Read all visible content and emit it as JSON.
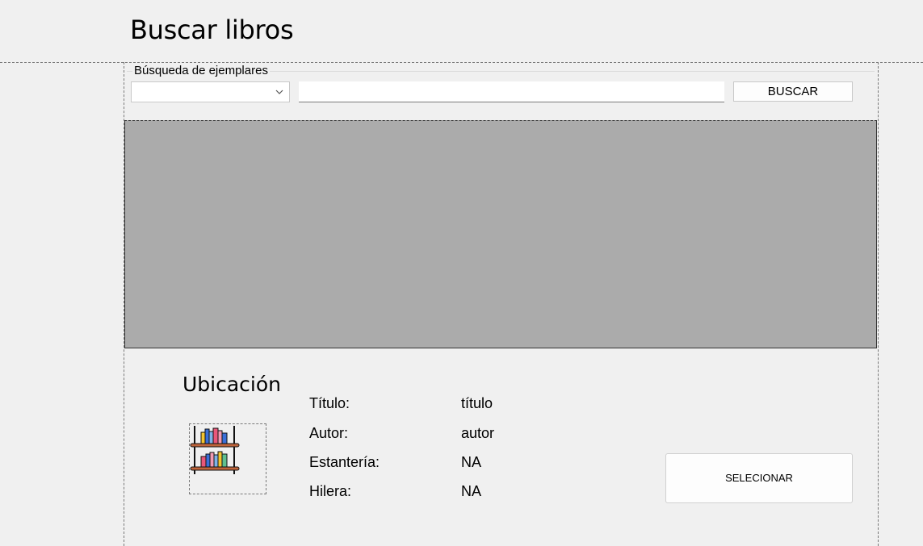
{
  "header": {
    "title": "Buscar libros"
  },
  "search": {
    "legend": "Búsqueda de ejemplares",
    "combo_value": "",
    "input_value": "",
    "button_label": "BUSCAR"
  },
  "location": {
    "title": "Ubicación",
    "fields": [
      {
        "label": "Título:",
        "value": "título"
      },
      {
        "label": "Autor:",
        "value": "autor"
      },
      {
        "label": "Estantería:",
        "value": "NA"
      },
      {
        "label": "Hilera:",
        "value": "NA"
      }
    ],
    "image_icon": "bookshelf-icon"
  },
  "actions": {
    "select_label": "SELECIONAR"
  },
  "colors": {
    "background": "#f0f0f0",
    "grid_background": "#ababab"
  }
}
